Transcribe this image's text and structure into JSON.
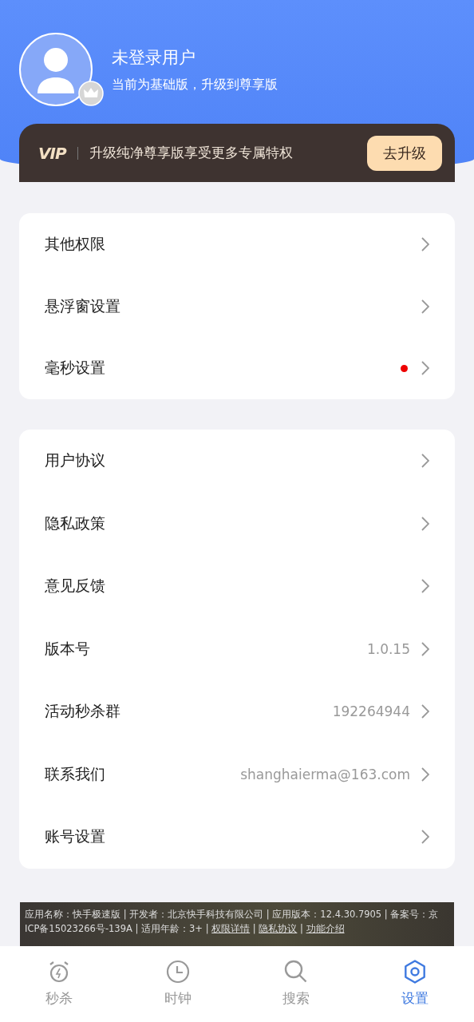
{
  "profile": {
    "name": "未登录用户",
    "subtitle": "当前为基础版，升级到尊享版"
  },
  "vip_banner": {
    "logo": "VIP",
    "text": "升级纯净尊享版享受更多专属特权",
    "button": "去升级"
  },
  "groups": [
    {
      "rows": [
        {
          "label": "其他权限",
          "dot": false
        },
        {
          "label": "悬浮窗设置",
          "dot": false
        },
        {
          "label": "毫秒设置",
          "dot": true
        }
      ]
    },
    {
      "rows": [
        {
          "label": "用户协议",
          "dot": false
        },
        {
          "label": "隐私政策",
          "dot": false
        },
        {
          "label": "意见反馈",
          "dot": false
        },
        {
          "label": "版本号",
          "value": "1.0.15",
          "dot": false
        },
        {
          "label": "活动秒杀群",
          "value": "192264944",
          "dot": false
        },
        {
          "label": "联系我们",
          "value": "shanghaierma@163.com",
          "dot": false
        },
        {
          "label": "账号设置",
          "dot": false
        }
      ]
    }
  ],
  "ad": {
    "info": "应用名称：快手极速版 | 开发者：北京快手科技有限公司 | 应用版本：12.4.30.7905 | 备案号：京ICP备15023266号-139A | 适用年龄：3+ |",
    "links": [
      "权限详情",
      "隐私协议",
      "功能介绍"
    ],
    "separator": "|"
  },
  "tabs": [
    {
      "label": "秒杀",
      "kind": "alarm",
      "selected": false
    },
    {
      "label": "时钟",
      "kind": "clock",
      "selected": false
    },
    {
      "label": "搜索",
      "kind": "search",
      "selected": false
    },
    {
      "label": "设置",
      "kind": "gear",
      "selected": true
    }
  ]
}
